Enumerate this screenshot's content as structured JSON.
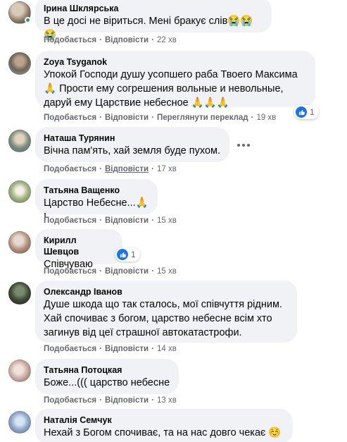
{
  "actions": {
    "like": "Подобається",
    "reply": "Відповісти",
    "see_translation": "Переглянути переклад"
  },
  "colors": {
    "bubble": "#f0f2f5",
    "meta": "#65676b",
    "like_blue": "#1b74e4",
    "online": "#31a24c"
  },
  "comments": [
    {
      "author": "Ірина Шклярська",
      "text": "В це досі не віриться. Мені бракує слів😭😭😭",
      "time": "22 хв",
      "avatar_icon": "profile-photo-icon"
    },
    {
      "author": "Zoya Tsyganok",
      "text": "Упокой Господи душу усопшего раба Твоего Максима 🙏 Прости ему согрешения вольные и невольные, даруй ему Царствие небесное 🙏🙏🙏",
      "time": "19 хв",
      "reactions": "1",
      "avatar_icon": "profile-photo-icon"
    },
    {
      "author": "Наташа Турянин",
      "text": "Вічна пам'ять, хай земля буде пухом.",
      "time": "17 хв",
      "avatar_icon": "profile-photo-icon"
    },
    {
      "author": "Татьяна Ващенко",
      "text": "Царство Небесне...🙏 !",
      "time": "15 хв",
      "avatar_icon": "profile-photo-icon"
    },
    {
      "author": "Кирилл Шевцов",
      "text": "Співчуваю",
      "time": "15 хв",
      "reactions": "1",
      "avatar_icon": "profile-photo-icon"
    },
    {
      "author": "Олександр Іванов",
      "text": "Душе шкода що так сталось, мої співчуття рідним. Хай спочиває з богом, царство небесне всім хто загинув від цеї страшної автокатастрофи.",
      "time": "14 хв",
      "avatar_icon": "profile-photo-icon"
    },
    {
      "author": "Татьяна Потоцкая",
      "text": "Боже...((( царство небесне",
      "time": "13 хв",
      "avatar_icon": "profile-photo-icon"
    },
    {
      "author": "Наталія Семчук",
      "text": "Нехай з Богом спочиває, та на нас довго чекає ☺️",
      "time": "",
      "avatar_icon": "profile-photo-icon"
    }
  ]
}
